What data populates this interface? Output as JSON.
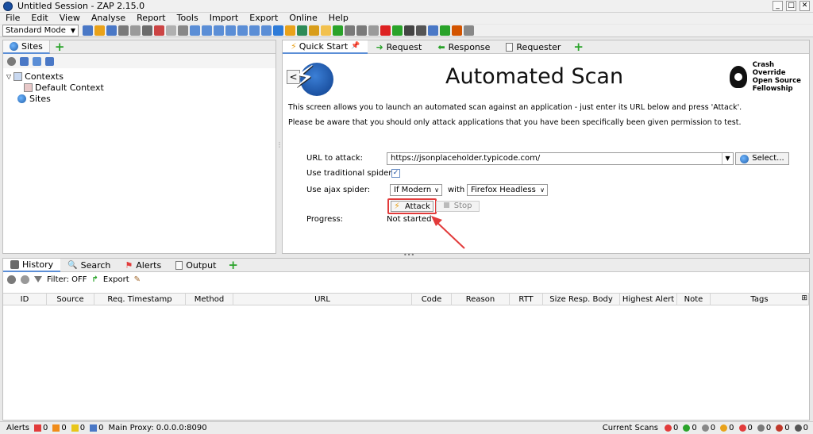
{
  "window": {
    "title": "Untitled Session - ZAP 2.15.0",
    "controls": [
      "_",
      "□",
      "✕"
    ]
  },
  "menu": [
    "File",
    "Edit",
    "View",
    "Analyse",
    "Report",
    "Tools",
    "Import",
    "Export",
    "Online",
    "Help"
  ],
  "toolbar": {
    "mode": "Standard Mode",
    "icon_colors": [
      "#4a78c6",
      "#e9a21a",
      "#4a78c6",
      "#7a7a7a",
      "#9a9a9a",
      "#6b6b6b",
      "#c44",
      "#b0b0b0",
      "#888",
      "#5b8ed6",
      "#5b8ed6",
      "#5b8ed6",
      "#5b8ed6",
      "#5b8ed6",
      "#5b8ed6",
      "#5b8ed6",
      "#2e7bd8",
      "#e9a21a",
      "#2e8b57",
      "#d89d1a",
      "#f2c14e",
      "#2aa32a",
      "#7a7a7a",
      "#7a7a7a",
      "#9a9a9a",
      "#d22",
      "#2aa32a",
      "#444",
      "#555",
      "#4a78c6",
      "#2aa32a",
      "#d35400",
      "#888"
    ]
  },
  "sites_panel": {
    "tab": "Sites",
    "tree": {
      "contexts": "Contexts",
      "default_context": "Default Context",
      "sites": "Sites"
    }
  },
  "right_tabs": {
    "quick_start": "Quick Start",
    "request": "Request",
    "response": "Response",
    "requester": "Requester"
  },
  "quick_start": {
    "back": "<",
    "title": "Automated Scan",
    "partner": {
      "line1": "Crash Override",
      "line2": "Open Source",
      "line3": "Fellowship"
    },
    "description_1": "This screen allows you to launch an automated scan against  an application - just enter its URL below and press 'Attack'.",
    "description_2": "Please be aware that you should only attack applications that you have been specifically been given permission to test.",
    "url_label": "URL to attack:",
    "url_value": "https://jsonplaceholder.typicode.com/",
    "select_label": "Select...",
    "traditional_spider_label": "Use traditional spider:",
    "traditional_spider_checked": true,
    "ajax_spider_label": "Use ajax spider:",
    "ajax_mode": "If Modern",
    "with_label": "with",
    "browser": "Firefox Headless",
    "attack_label": "Attack",
    "stop_label": "Stop",
    "progress_label": "Progress:",
    "progress_value": "Not started"
  },
  "bottom_tabs": {
    "history": "History",
    "search": "Search",
    "alerts": "Alerts",
    "output": "Output"
  },
  "history_tools": {
    "filter": "Filter: OFF",
    "export": "Export"
  },
  "table_columns": [
    "ID",
    "Source",
    "Req. Timestamp",
    "Method",
    "URL",
    "Code",
    "Reason",
    "RTT",
    "Size Resp. Body",
    "Highest Alert",
    "Note",
    "Tags"
  ],
  "status": {
    "alerts_label": "Alerts",
    "alert_counts": [
      {
        "color": "#e23b3b",
        "count": "0"
      },
      {
        "color": "#f08c1a",
        "count": "0"
      },
      {
        "color": "#e8c61a",
        "count": "0"
      },
      {
        "color": "#4a78c6",
        "count": "0"
      }
    ],
    "proxy": "Main Proxy: 0.0.0.0:8090",
    "current_scans_label": "Current Scans",
    "scan_counts": [
      {
        "color": "#e23b3b",
        "count": "0"
      },
      {
        "color": "#2aa32a",
        "count": "0"
      },
      {
        "color": "#888888",
        "count": "0"
      },
      {
        "color": "#e9a21a",
        "count": "0"
      },
      {
        "color": "#e23b3b",
        "count": "0"
      },
      {
        "color": "#7a7a7a",
        "count": "0"
      },
      {
        "color": "#c0392b",
        "count": "0"
      },
      {
        "color": "#555555",
        "count": "0"
      }
    ]
  }
}
